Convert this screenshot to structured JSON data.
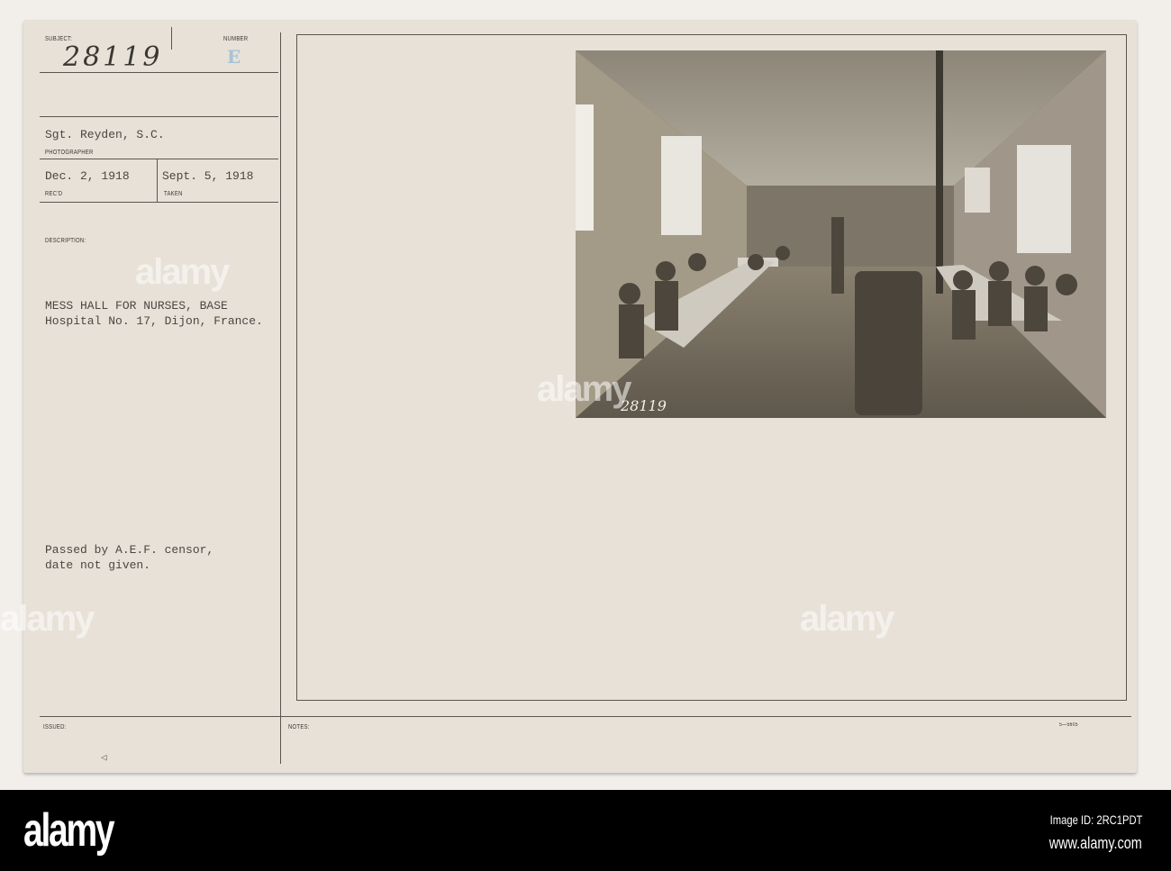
{
  "card": {
    "subject_label": "SUBJECT:",
    "subject_number": "28119",
    "number_label": "NUMBER",
    "number_value": "E",
    "photographer": "Sgt. Reyden, S.C.",
    "photographer_label": "PHOTOGRAPHER",
    "received": "Dec. 2, 1918",
    "received_label": "REC'D",
    "taken": "Sept. 5, 1918",
    "taken_label": "TAKEN",
    "description_label": "DESCRIPTION:",
    "description_line1": "MESS HALL FOR NURSES, BASE",
    "description_line2": "Hospital No. 17, Dijon, France.",
    "censor_line1": "Passed by A.E.F. censor,",
    "censor_line2": "date not given.",
    "issued_label": "ISSUED:",
    "notes_label": "NOTES:",
    "form_number": "5—5605",
    "photo_caption": "28119"
  },
  "banner": {
    "logo": "alamy",
    "image_id": "Image ID: 2RC1PDT",
    "url": "www.alamy.com"
  },
  "watermark": "alamy"
}
